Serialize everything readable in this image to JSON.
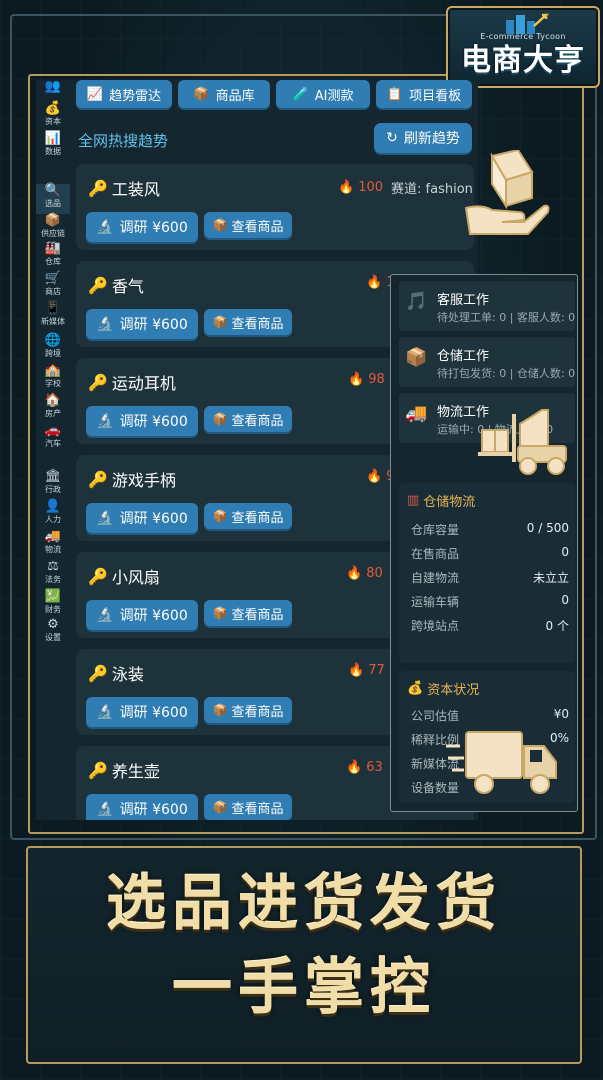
{
  "logo": {
    "subtitle": "E-commerce Tycoon",
    "title": "电商大亨"
  },
  "sidebar": {
    "items": [
      {
        "label": "资本",
        "icon": "money-bag-icon",
        "glyph": "💰"
      },
      {
        "label": "数据",
        "icon": "chart-icon",
        "glyph": "📊"
      },
      {
        "label": "选品",
        "icon": "search-icon",
        "glyph": "🔍",
        "active": true
      },
      {
        "label": "供应链",
        "icon": "box-icon",
        "glyph": "📦"
      },
      {
        "label": "仓库",
        "icon": "warehouse-icon",
        "glyph": "🏭"
      },
      {
        "label": "商店",
        "icon": "cart-icon",
        "glyph": "🛒"
      },
      {
        "label": "新媒体",
        "icon": "phone-icon",
        "glyph": "📱"
      },
      {
        "label": "跨境",
        "icon": "globe-icon",
        "glyph": "🌐"
      },
      {
        "label": "学校",
        "icon": "school-icon",
        "glyph": "🏫"
      },
      {
        "label": "房产",
        "icon": "house-icon",
        "glyph": "🏠"
      },
      {
        "label": "汽车",
        "icon": "car-icon",
        "glyph": "🚗"
      },
      {
        "label": "行政",
        "icon": "bank-icon",
        "glyph": "🏛"
      },
      {
        "label": "人力",
        "icon": "person-icon",
        "glyph": "👤"
      },
      {
        "label": "物流",
        "icon": "truck-icon",
        "glyph": "🚚"
      },
      {
        "label": "法务",
        "icon": "scales-icon",
        "glyph": "⚖"
      },
      {
        "label": "财务",
        "icon": "finance-icon",
        "glyph": "💹"
      },
      {
        "label": "设置",
        "icon": "gear-icon",
        "glyph": "⚙"
      }
    ]
  },
  "tabs": [
    {
      "label": "趋势雷达",
      "icon": "radar-icon",
      "glyph": "📈"
    },
    {
      "label": "商品库",
      "icon": "box-icon",
      "glyph": "📦"
    },
    {
      "label": "AI测款",
      "icon": "test-tube-icon",
      "glyph": "🧪"
    },
    {
      "label": "项目看板",
      "icon": "clipboard-icon",
      "glyph": "📋"
    }
  ],
  "trends": {
    "title": "全网热搜趋势",
    "refresh_label": "刷新趋势",
    "items": [
      {
        "keyword": "工装风",
        "heat": "100",
        "track_label": "赛道: fashion",
        "research": "调研 ¥600",
        "view": "查看商品"
      },
      {
        "keyword": "香气",
        "heat": "1",
        "track_label": "",
        "research": "调研 ¥600",
        "view": "查看商品"
      },
      {
        "keyword": "运动耳机",
        "heat": "98",
        "track_label": "",
        "research": "调研 ¥600",
        "view": "查看商品"
      },
      {
        "keyword": "游戏手柄",
        "heat": "9",
        "track_label": "",
        "research": "调研 ¥600",
        "view": "查看商品"
      },
      {
        "keyword": "小风扇",
        "heat": "80",
        "track_label": "",
        "research": "调研 ¥600",
        "view": "查看商品"
      },
      {
        "keyword": "泳装",
        "heat": "77",
        "track_label": "",
        "research": "调研 ¥600",
        "view": "查看商品"
      },
      {
        "keyword": "养生壶",
        "heat": "63",
        "track_label": "",
        "research": "调研 ¥600",
        "view": "查看商品"
      }
    ]
  },
  "jobs": [
    {
      "title": "客服工作",
      "status": "待处理工单: 0 | 客服人数: 0",
      "icon": "music-note-icon",
      "glyph": "🎵"
    },
    {
      "title": "仓储工作",
      "status": "待打包发货: 0 | 仓储人数: 0",
      "icon": "box-icon",
      "glyph": "📦"
    },
    {
      "title": "物流工作",
      "status": "运输中: 0 | 物流人数: 0",
      "icon": "truck-icon",
      "glyph": "🚚"
    }
  ],
  "warehouse_logistics": {
    "title": "仓储物流",
    "rows": [
      {
        "label": "仓库容量",
        "value": "0 / 500"
      },
      {
        "label": "在售商品",
        "value": "0"
      },
      {
        "label": "自建物流",
        "value": "未立立"
      },
      {
        "label": "运输车辆",
        "value": "0"
      },
      {
        "label": "跨境站点",
        "value": "0 个"
      }
    ]
  },
  "capital": {
    "title": "资本状况",
    "rows": [
      {
        "label": "公司估值",
        "value": "¥0"
      },
      {
        "label": "稀释比例",
        "value": "0%"
      },
      {
        "label": "新媒体流",
        "value": ""
      },
      {
        "label": "设备数量",
        "value": ""
      }
    ]
  },
  "banner": {
    "line1": "选品进货发货",
    "line2": "一手掌控"
  }
}
